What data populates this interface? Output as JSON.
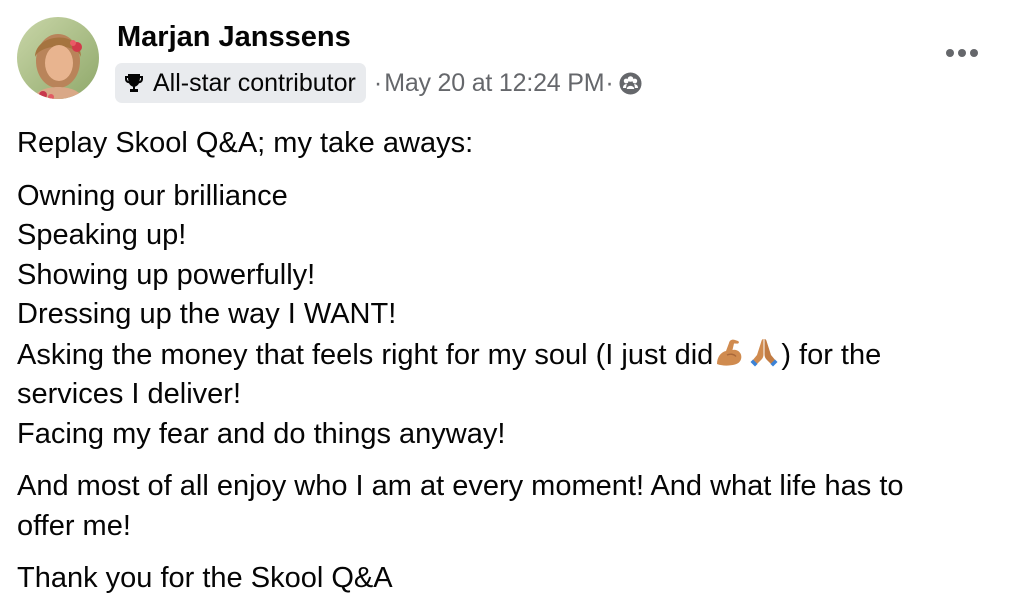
{
  "post": {
    "author": {
      "name": "Marjan Janssens",
      "badge": "All-star contributor",
      "badge_icon": "trophy-icon"
    },
    "timestamp": "May 20 at 12:24 PM",
    "separator": "·",
    "audience_icon": "group-audience-icon",
    "more_icon": "more-options-icon",
    "content": {
      "intro": "Replay Skool Q&A; my take aways:",
      "lines": [
        "Owning our brilliance",
        "Speaking up!",
        "Showing up powerfully!",
        "Dressing up the way I WANT!"
      ],
      "money_line_before": "Asking the money that feels right for my soul (I just did",
      "money_line_emojis": [
        "flexed-biceps-emoji",
        "folded-hands-emoji"
      ],
      "money_line_after": ") for the",
      "money_line_wrap": "services I deliver!",
      "fear_line": "Facing my fear and do things anyway!",
      "enjoy_line_1": "And most of all enjoy who I am at every moment! And what life has to",
      "enjoy_line_2": "offer me!",
      "thanks": "Thank you for the Skool Q&A"
    }
  },
  "colors": {
    "text": "#050505",
    "secondary_text": "#65676b",
    "badge_background": "#e9ebee"
  }
}
